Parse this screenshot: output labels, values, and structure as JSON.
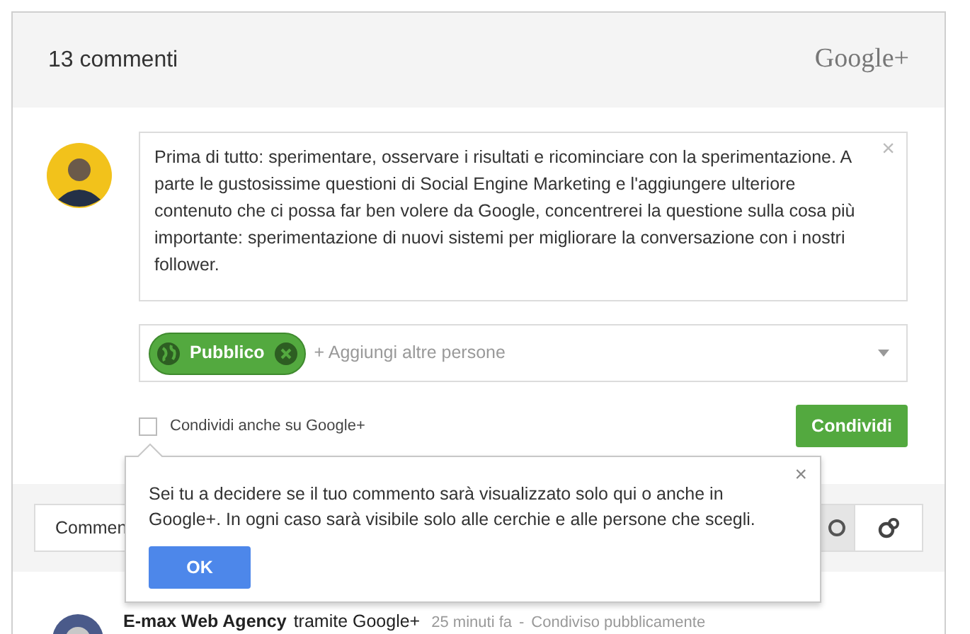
{
  "header": {
    "title": "13 commenti",
    "brand": "Google+"
  },
  "composer": {
    "text": "Prima di tutto: sperimentare, osservare i risultati e ricominciare con la sperimentazione. A parte le gustosissime questioni di Social Engine Marketing e l'aggiungere ulteriore contenuto che ci possa far ben volere da Google, concentrerei la questione sulla cosa più importante: sperimentazione di nuovi sistemi per migliorare la conversazione con i nostri follower.",
    "close": "×"
  },
  "audience": {
    "chip": "Pubblico",
    "placeholder": "+ Aggiungi altre persone"
  },
  "share_also": {
    "label": "Condividi anche su Google+",
    "checked": false
  },
  "submit": "Condividi",
  "toolbar": {
    "tab": "Commen"
  },
  "popup": {
    "text": "Sei tu a decidere se il tuo commento sarà visualizzato solo qui o anche in Google+. In ogni caso sarà visibile solo alle cerchie e alle persone che scegli.",
    "close": "×",
    "button": "OK"
  },
  "post": {
    "author": "E-max Web Agency",
    "via": "tramite Google+",
    "time": "25 minuti fa",
    "separator": "-",
    "visibility": "Condiviso pubblicamente"
  }
}
